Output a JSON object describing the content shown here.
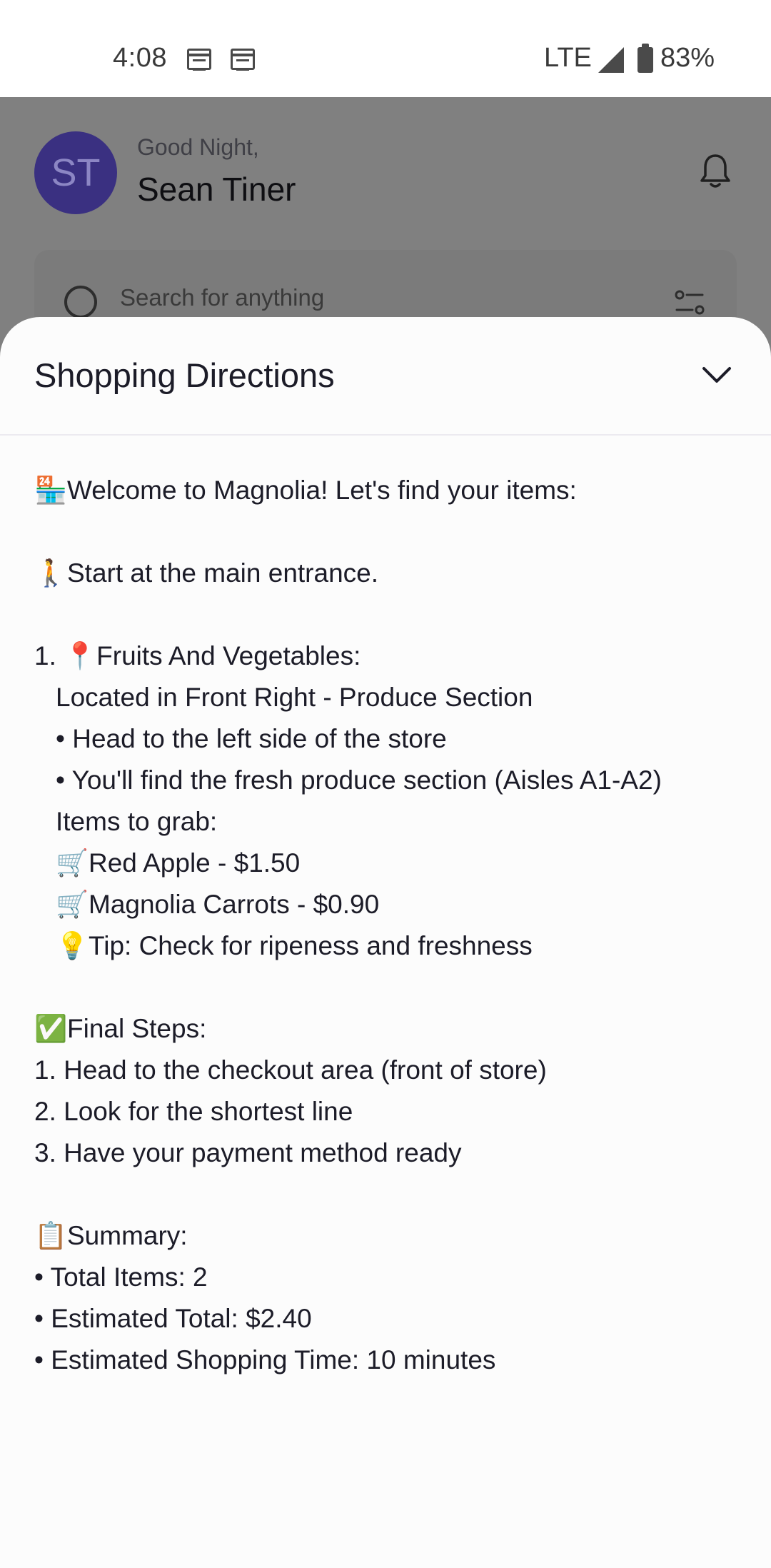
{
  "status_bar": {
    "time": "4:08",
    "network": "LTE",
    "battery": "83%"
  },
  "header": {
    "avatar_initials": "ST",
    "greeting": "Good Night,",
    "user_name": "Sean Tiner"
  },
  "search": {
    "placeholder": "Search for anything"
  },
  "sheet": {
    "title": "Shopping Directions",
    "welcome": {
      "emoji": "🏪",
      "text": "Welcome to Magnolia! Let's find your items:"
    },
    "start": {
      "emoji": "🚶",
      "text": "Start at the main entrance."
    },
    "section": {
      "number": "1.",
      "emoji": "📍",
      "heading": "Fruits And Vegetables:",
      "location": "Located in Front Right - Produce Section",
      "directions": [
        "• Head to the left side of the store",
        "• You'll find the fresh produce section (Aisles A1-A2)"
      ],
      "items_label": "Items to grab:",
      "items": [
        {
          "emoji": "🛒",
          "text": "Red Apple - $1.50"
        },
        {
          "emoji": "🛒",
          "text": "Magnolia Carrots - $0.90"
        }
      ],
      "tip": {
        "emoji": "💡",
        "text": "Tip: Check for ripeness and freshness"
      }
    },
    "final_steps": {
      "emoji": "✅",
      "heading": "Final Steps:",
      "steps": [
        "1. Head to the checkout area (front of store)",
        "2. Look for the shortest line",
        "3. Have your payment method ready"
      ]
    },
    "summary": {
      "emoji": "📋",
      "heading": "Summary:",
      "lines": [
        "• Total Items: 2",
        "• Estimated Total: $2.40",
        "• Estimated Shopping Time: 10 minutes"
      ]
    }
  }
}
